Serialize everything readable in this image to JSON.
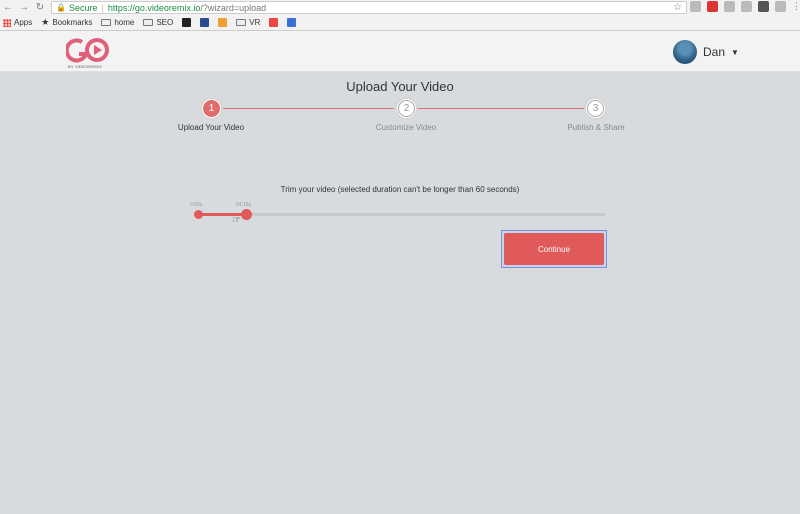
{
  "browser": {
    "secure_label": "Secure",
    "url_host": "https://go.videoremix.io",
    "url_rest": "/?wizard=upload",
    "bookmarks": [
      {
        "label": "Apps"
      },
      {
        "label": "Bookmarks"
      },
      {
        "label": "home"
      },
      {
        "label": "SEO"
      },
      {
        "label": "VR"
      }
    ]
  },
  "header": {
    "logo_sub": "BY VIDEOREMIX",
    "user_name": "Dan"
  },
  "wizard": {
    "title": "Upload Your Video",
    "steps": [
      {
        "number": "1",
        "label": "Upload Your Video",
        "active": true
      },
      {
        "number": "2",
        "label": "Customize Video",
        "active": false
      },
      {
        "number": "3",
        "label": "Publish & Share",
        "active": false
      }
    ]
  },
  "trimmer": {
    "instruction": "Trim your video (selected duration can't be longer than 60 seconds)",
    "start_label": "0.00s",
    "end_label": "54.15s"
  },
  "actions": {
    "continue_label": "Continue"
  }
}
